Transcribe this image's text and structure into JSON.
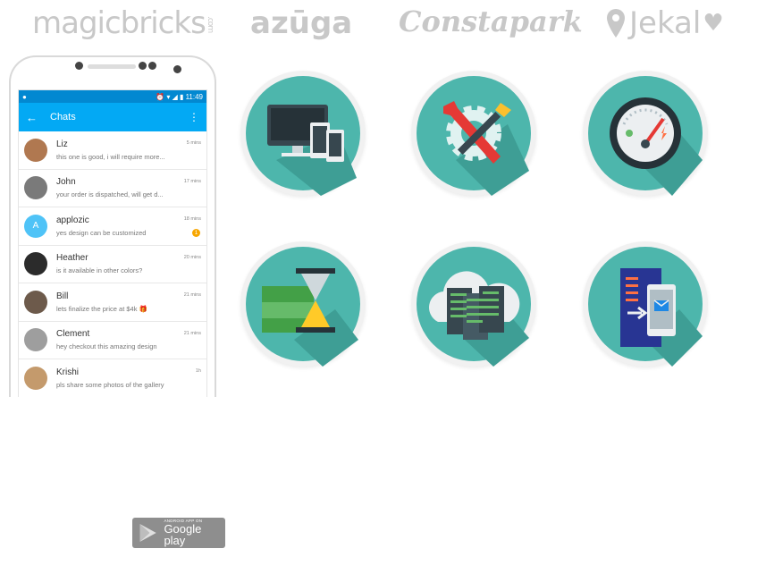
{
  "logos": {
    "magicbricks": "magicbricks",
    "magicbricks_suffix": ".com",
    "azuga": "azūga",
    "constapark": "Constapark",
    "jekal": "Jekal"
  },
  "phone": {
    "status_time": "11:49",
    "app_title": "Chats",
    "chats": [
      {
        "name": "Liz",
        "message": "this one is good, i will require more...",
        "time": "5 mins"
      },
      {
        "name": "John",
        "message": "your order is dispatched, will get d...",
        "time": "17 mins"
      },
      {
        "name": "applozic",
        "message": "yes design can be customized",
        "time": "18 mins",
        "initial": "A",
        "badge": "1"
      },
      {
        "name": "Heather",
        "message": "is it available in other colors?",
        "time": "20 mins"
      },
      {
        "name": "Bill",
        "message": "lets finalize the price at $4k",
        "time": "21 mins"
      },
      {
        "name": "Clement",
        "message": "hey checkout this amazing design",
        "time": "21 mins"
      },
      {
        "name": "Krishi",
        "message": "pls share some photos of the gallery",
        "time": "1h"
      }
    ]
  },
  "features": [
    "devices-icon",
    "tools-icon",
    "speedometer-icon",
    "money-hourglass-icon",
    "cloud-servers-icon",
    "server-phone-icon"
  ],
  "play_badge": {
    "small": "ANDROID APP ON",
    "big": "Google play"
  },
  "colors": {
    "teal": "#4db6ac",
    "teal_dark": "#3e9e95",
    "accent": "#03a9f4",
    "status": "#0288d1"
  }
}
